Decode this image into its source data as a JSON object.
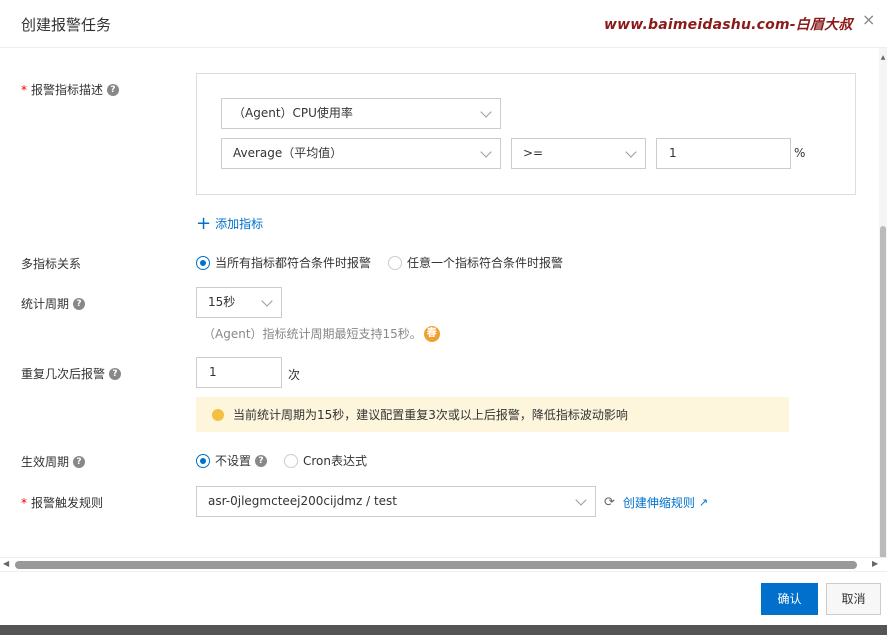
{
  "dialog": {
    "title": "创建报警任务",
    "watermark": "www.baimeidashu.com-白眉大叔",
    "close_icon": "×"
  },
  "metric": {
    "label": "报警指标描述",
    "metric_name": "（Agent）CPU使用率",
    "aggregation": "Average（平均值）",
    "operator": ">=",
    "threshold": "1",
    "unit": "%",
    "add_link": "添加指标"
  },
  "multi": {
    "label": "多指标关系",
    "option_all": "当所有指标都符合条件时报警",
    "option_any": "任意一个指标符合条件时报警"
  },
  "period": {
    "label": "统计周期",
    "value": "15秒",
    "hint": "（Agent）指标统计周期最短支持15秒。",
    "spring_badge": "春"
  },
  "repeat": {
    "label": "重复几次后报警",
    "value": "1",
    "unit": "次",
    "warning": "当前统计周期为15秒，建议配置重复3次或以上后报警，降低指标波动影响"
  },
  "effective": {
    "label": "生效周期",
    "option_none": "不设置",
    "option_cron": "Cron表达式"
  },
  "rule": {
    "label": "报警触发规则",
    "value": "asr-0jlegmcteej200cijdmz / test",
    "create_link": "创建伸缩规则"
  },
  "footer": {
    "confirm": "确认",
    "cancel": "取消"
  }
}
